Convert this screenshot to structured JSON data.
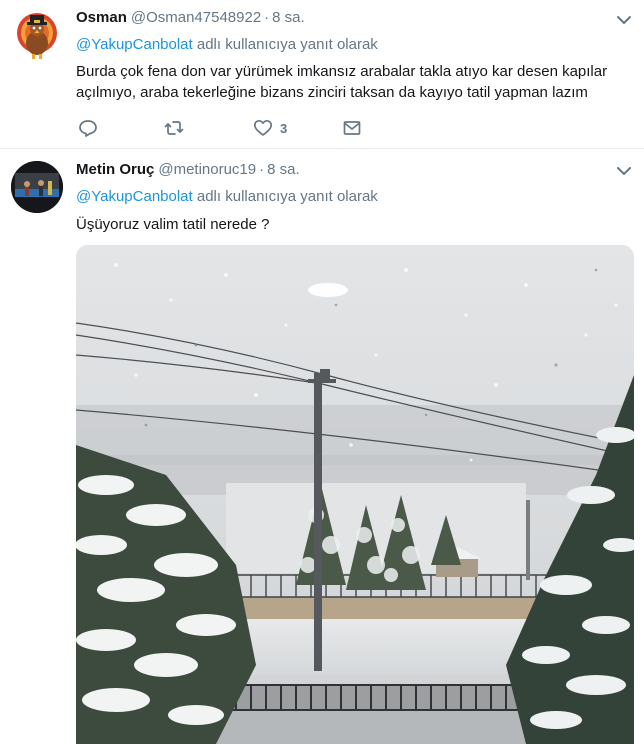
{
  "tweets": [
    {
      "name": "Osman",
      "handle": "@Osman47548922",
      "separator": "·",
      "time": "8 sa.",
      "reply_mention": "@YakupCanbolat",
      "reply_suffix": " adlı kullanıcıya yanıt olarak",
      "text_lines": [
        "Burda çok fena don var yürümek imkansız arabalar takla atıyo kar desen kapılar",
        "açılmıyo, araba tekerleğine bizans zinciri taksan da kayıyo tatil yapman lazım"
      ],
      "actions": {
        "reply_icon": "reply-icon",
        "retweet_icon": "retweet-icon",
        "like_icon": "heart-icon",
        "like_count": "3",
        "dm_icon": "envelope-icon"
      },
      "avatar_icon": "turkey-avatar"
    },
    {
      "name": "Metin Oruç",
      "handle": "@metinoruc19",
      "separator": "·",
      "time": "8 sa.",
      "reply_mention": "@YakupCanbolat",
      "reply_suffix": " adlı kullanıcıya yanıt olarak",
      "text_lines": [
        "Üşüyoruz valim tatil nerede ?"
      ],
      "media": "snowy-street-photo",
      "avatar_icon": "photo-avatar"
    }
  ],
  "colors": {
    "link": "#1b95e0",
    "secondary": "#657786",
    "primary_text": "#14171a",
    "divider": "#e6ecf0"
  }
}
